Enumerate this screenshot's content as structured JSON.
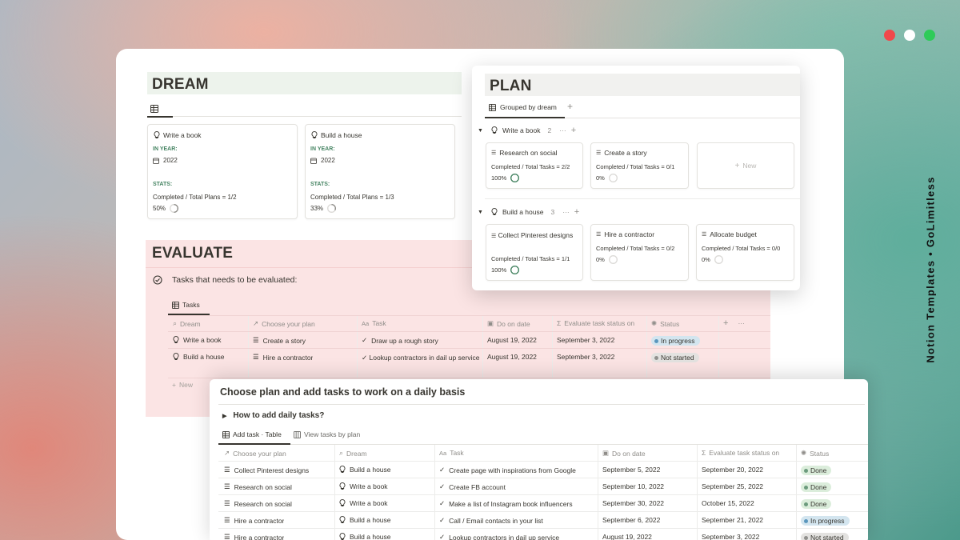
{
  "brand": {
    "vertical_text": "Notion Templates • GoLimitless"
  },
  "window_controls": [
    "close",
    "minimize",
    "maximize"
  ],
  "colors": {
    "close": "#f0494b",
    "minimize": "#ffffff",
    "maximize": "#2ecb58",
    "dream_header_bg": "#edf3ec",
    "evaluate_bg": "#fbe4e4",
    "in_progress_bg": "#d3e5ef",
    "in_progress_dot": "#5b97bd",
    "not_started_bg": "#e3e2e0",
    "not_started_dot": "#91918e",
    "done_bg": "#dbeddb",
    "done_dot": "#6c9b7d",
    "stats_green": "#448361"
  },
  "dream": {
    "title": "DREAM",
    "cards": [
      {
        "title": "Write a book",
        "year_label": "IN YEAR:",
        "year": "2022",
        "stats_label": "STATS:",
        "stats_text": "Completed / Total Plans = 1/2",
        "percent": "50%",
        "progress": 0.5
      },
      {
        "title": "Build a house",
        "year_label": "IN YEAR:",
        "year": "2022",
        "stats_label": "STATS:",
        "stats_text": "Completed / Total Plans = 1/3",
        "percent": "33%",
        "progress": 0.33
      }
    ]
  },
  "plan": {
    "title": "PLAN",
    "view_tab": "Grouped by dream",
    "groups": [
      {
        "name": "Write a book",
        "count": "2",
        "cards": [
          {
            "title": "Research on social",
            "stats": "Completed / Total Tasks = 2/2",
            "percent": "100%",
            "progress": 1.0
          },
          {
            "title": "Create a story",
            "stats": "Completed / Total Tasks = 0/1",
            "percent": "0%",
            "progress": 0.0
          }
        ],
        "new_label": "New"
      },
      {
        "name": "Build a house",
        "count": "3",
        "cards": [
          {
            "title": "Collect Pinterest designs",
            "stats": "Completed / Total Tasks = 1/1",
            "percent": "100%",
            "progress": 1.0
          },
          {
            "title": "Hire a contractor",
            "stats": "Completed / Total Tasks = 0/2",
            "percent": "0%",
            "progress": 0.0
          },
          {
            "title": "Allocate budget",
            "stats": "Completed / Total Tasks = 0/0",
            "percent": "0%",
            "progress": 0.0
          }
        ]
      }
    ]
  },
  "evaluate": {
    "title": "EVALUATE",
    "callout": "Tasks that needs to be evaluated:",
    "tab": "Tasks",
    "columns": [
      "Dream",
      "Choose your plan",
      "Task",
      "Do on date",
      "Evaluate task status on",
      "Status"
    ],
    "rows": [
      {
        "dream": "Write a book",
        "plan": "Create a story",
        "task": "Draw up a rough story",
        "do_on": "August 19, 2022",
        "evaluate_on": "September 3, 2022",
        "status": "In progress"
      },
      {
        "dream": "Build a house",
        "plan": "Hire a contractor",
        "task": "Lookup contractors in dail up service",
        "do_on": "August 19, 2022",
        "evaluate_on": "September 3, 2022",
        "status": "Not started"
      }
    ],
    "new_label": "New"
  },
  "daily": {
    "title": "Choose plan and add tasks to work on a daily basis",
    "toggle": "How to add daily tasks?",
    "tabs": [
      "Add task · Table",
      "View tasks by plan"
    ],
    "columns": [
      "Choose your plan",
      "Dream",
      "Task",
      "Do on date",
      "Evaluate task status on",
      "Status"
    ],
    "rows": [
      {
        "plan": "Collect Pinterest designs",
        "dream": "Build a house",
        "task": "Create page with inspirations from Google",
        "do_on": "September 5, 2022",
        "evaluate_on": "September 20, 2022",
        "status": "Done"
      },
      {
        "plan": "Research on social",
        "dream": "Write a book",
        "task": "Create FB account",
        "do_on": "September 10, 2022",
        "evaluate_on": "September 25, 2022",
        "status": "Done"
      },
      {
        "plan": "Research on social",
        "dream": "Write a book",
        "task": "Make a list of Instagram book influencers",
        "do_on": "September 30, 2022",
        "evaluate_on": "October 15, 2022",
        "status": "Done"
      },
      {
        "plan": "Hire a contractor",
        "dream": "Build a house",
        "task": "Call / Email contacts in your list",
        "do_on": "September 6, 2022",
        "evaluate_on": "September 21, 2022",
        "status": "In progress"
      },
      {
        "plan": "Hire a contractor",
        "dream": "Build a house",
        "task": "Lookup contractors in dail up service",
        "do_on": "August 19, 2022",
        "evaluate_on": "September 3, 2022",
        "status": "Not started"
      }
    ]
  }
}
